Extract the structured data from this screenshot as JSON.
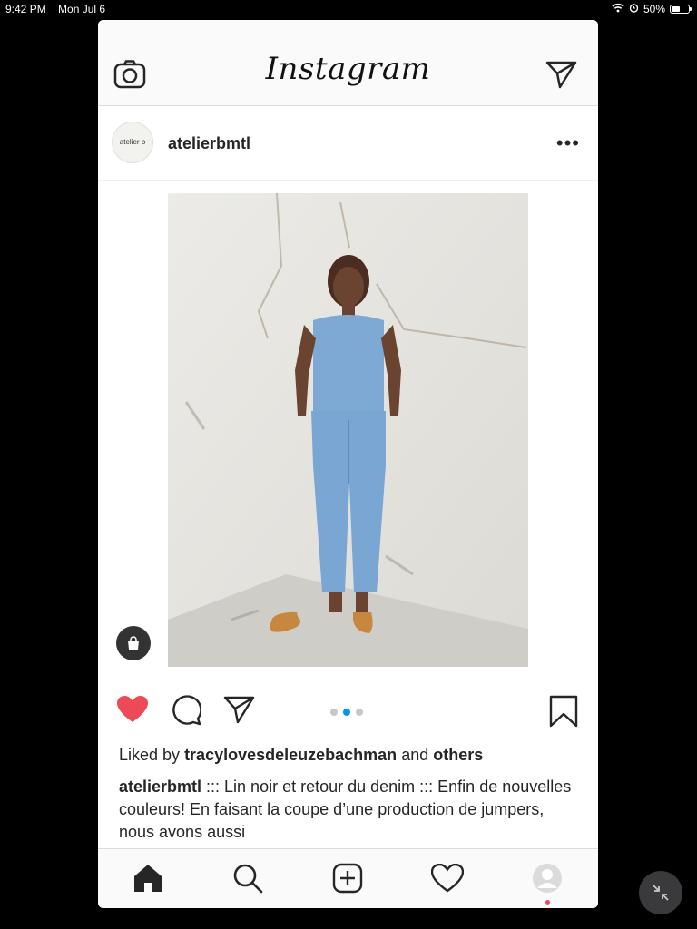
{
  "status_bar": {
    "time": "9:42 PM",
    "date": "Mon Jul 6",
    "battery": "50%",
    "battery_level": 0.5
  },
  "header": {
    "logo": "Instagram",
    "camera_icon": "camera-icon",
    "direct_icon": "paper-plane-icon"
  },
  "post": {
    "avatar_text": "atelier b",
    "username": "atelierbmtl",
    "more_icon": "more-icon",
    "carousel_total": 3,
    "carousel_current": 2,
    "likes": {
      "prefix": "Liked by",
      "user": "tracylovesdeleuzebachman",
      "and": "and",
      "others": "others"
    },
    "caption": {
      "username": "atelierbmtl",
      "text": " ::: Lin noir et retour du denim ::: Enfin de nouvelles couleurs! En faisant la coupe d’une production de jumpers, nous avons aussi"
    }
  },
  "colors": {
    "like_red": "#ed4956",
    "carousel_blue": "#0095f6",
    "icon_dark": "#262626"
  },
  "tab_bar": {
    "items": [
      "home-icon",
      "search-icon",
      "add-icon",
      "heart-icon",
      "profile-icon"
    ]
  }
}
